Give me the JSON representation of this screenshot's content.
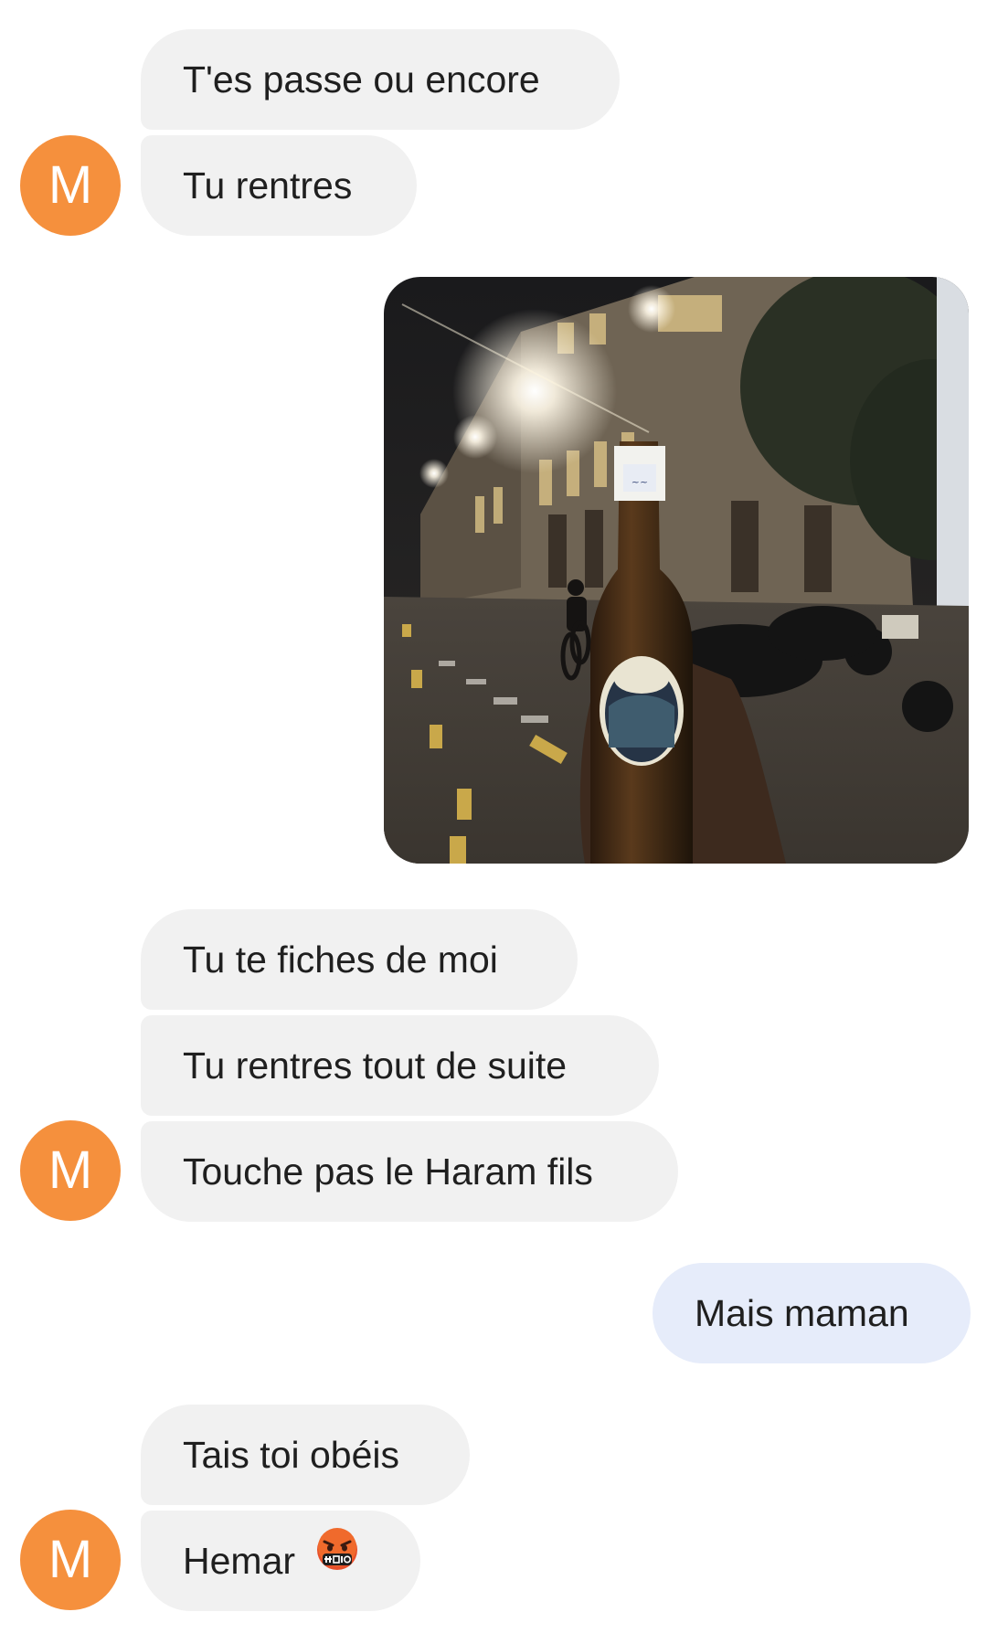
{
  "contact": {
    "avatar_letter": "M",
    "avatar_color": "#f5903d"
  },
  "messages": [
    {
      "text": "T'es passe ou encore"
    },
    {
      "text": "Tu rentres"
    },
    {
      "type": "photo",
      "content": "image"
    },
    {
      "text": "Tu te fiches de moi"
    },
    {
      "text": "Tu rentres tout de suite"
    },
    {
      "text": "Touche pas le Haram fils"
    },
    {
      "text": "Mais maman"
    },
    {
      "text": "Tais toi obéis"
    },
    {
      "text": "Hemar",
      "emoji": "face-with-symbols-on-mouth-icon"
    }
  ],
  "colors": {
    "incoming_bubble": "#f1f1f1",
    "outgoing_bubble": "#e6ecfa"
  }
}
